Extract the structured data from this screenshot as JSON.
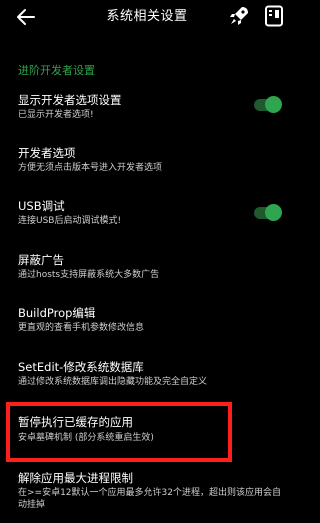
{
  "header": {
    "title": "系统相关设置",
    "back_icon": "arrow-left-icon",
    "rocket_icon": "rocket-icon",
    "panel_icon": "panel-icon"
  },
  "section": {
    "title": "进阶开发者设置"
  },
  "items": [
    {
      "title": "显示开发者选项设置",
      "subtitle": "已显示开发者选项!",
      "toggle": true
    },
    {
      "title": "开发者选项",
      "subtitle": "方便无须点击版本号进入开发者选项"
    },
    {
      "title": "USB调试",
      "subtitle": "连接USB后启动调试模式!",
      "toggle": true
    },
    {
      "title": "屏蔽广告",
      "subtitle": "通过hosts支持屏蔽系统大多数广告"
    },
    {
      "title": "BuildProp编辑",
      "subtitle": "更直观的查看手机参数修改信息"
    },
    {
      "title": "SetEdit-修改系统数据库",
      "subtitle": "通过修改系统数据库调出隐藏功能及完全自定义"
    },
    {
      "title": "暂停执行已缓存的应用",
      "subtitle": "安卓墓碑机制 (部分系统重启生效)"
    },
    {
      "title": "解除应用最大进程限制",
      "subtitle": "在>=安卓12默认一个应用最多允许32个进程，超出则该应用会自动挂掉"
    }
  ],
  "colors": {
    "accent": "#2ea24a",
    "highlight": "#ff1f1f",
    "background": "#000000"
  }
}
